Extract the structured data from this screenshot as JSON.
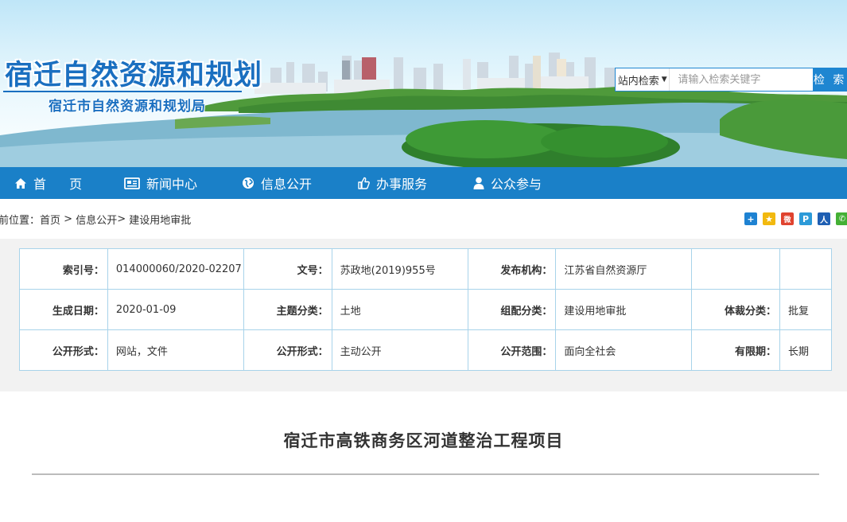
{
  "header": {
    "site_title": "宿迁自然资源和规划",
    "site_subtitle": "宿迁市自然资源和规划局",
    "search": {
      "scope": "站内检索",
      "placeholder": "请输入检索关键字",
      "button": "检 索"
    }
  },
  "nav": {
    "items": [
      {
        "label": "首 页",
        "icon": "home-icon"
      },
      {
        "label": "新闻中心",
        "icon": "newspaper-icon"
      },
      {
        "label": "信息公开",
        "icon": "globe-icon"
      },
      {
        "label": "办事服务",
        "icon": "thumbs-up-icon"
      },
      {
        "label": "公众参与",
        "icon": "user-icon"
      }
    ]
  },
  "breadcrumb": {
    "prefix": "前位置：",
    "items": [
      "首页",
      "信息公开",
      "建设用地审批"
    ],
    "separator": " > "
  },
  "share": {
    "icons": [
      {
        "name": "plus-share-icon",
        "color": "#1e82d2",
        "glyph": "+"
      },
      {
        "name": "qzone-share-icon",
        "color": "#f2b90f",
        "glyph": "★"
      },
      {
        "name": "weibo-share-icon",
        "color": "#e0432f",
        "glyph": "微"
      },
      {
        "name": "tencent-share-icon",
        "color": "#2c9ad8",
        "glyph": "P"
      },
      {
        "name": "renren-share-icon",
        "color": "#1f5fb3",
        "glyph": "人"
      },
      {
        "name": "wechat-share-icon",
        "color": "#44b035",
        "glyph": "✆"
      }
    ]
  },
  "info": {
    "row1": {
      "index_label": "索引号：",
      "index_value": "014000060/2020-02207",
      "doc_label": "文号：",
      "doc_value": "苏政地(2019)955号",
      "publisher_label": "发布机构：",
      "publisher_value": "江苏省自然资源厅"
    },
    "row2": {
      "date_label": "生成日期：",
      "date_value": "2020-01-09",
      "topic_label": "主题分类：",
      "topic_value": "土地",
      "group_label": "组配分类：",
      "group_value": "建设用地审批",
      "genre_label": "体裁分类：",
      "genre_value": "批复"
    },
    "row3": {
      "form_label": "公开形式：",
      "form_value": "网站，文件",
      "mode_label": "公开形式：",
      "mode_value": "主动公开",
      "scope_label": "公开范围：",
      "scope_value": "面向全社会",
      "validity_label": "有限期：",
      "validity_value": "长期"
    }
  },
  "article": {
    "title": "宿迁市高铁商务区河道整治工程项目"
  },
  "colors": {
    "nav": "#1a80c8",
    "brand": "#1a6fc0",
    "table_border": "#a8d3ea"
  }
}
